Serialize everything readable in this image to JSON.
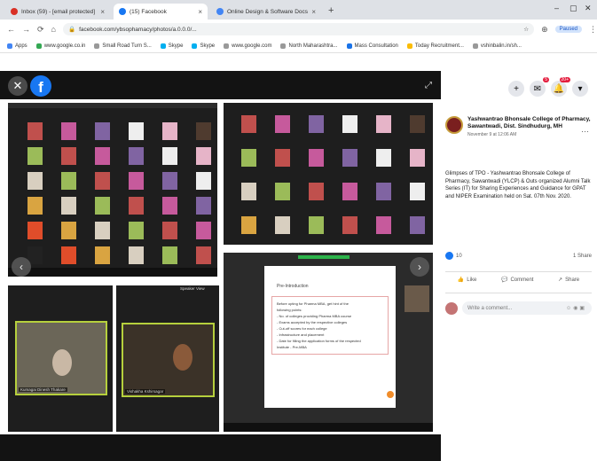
{
  "browser": {
    "tabs": [
      {
        "label": "Inbox (59) - [email protected]",
        "color": "#d93025",
        "active": false
      },
      {
        "label": "(15) Facebook",
        "color": "#1877f2",
        "active": true
      },
      {
        "label": "Online Design & Software Docs",
        "color": "#4285f4",
        "active": false
      }
    ],
    "url": "facebook.com/ybsophamacy/photos/a.0.0.0/...",
    "profile_status": "Paused",
    "bookmarks": [
      "Apps",
      "www.google.co.in",
      "Small Road Turn S...",
      "Skype",
      "Skype",
      "www.google.com",
      "North Maharashtra...",
      "Mass Consultation",
      "Today Recruitment...",
      "vshinbalin.in/sh..."
    ]
  },
  "viewer": {
    "speaker_view_label": "Speaker View",
    "slide": {
      "title": "Pre-Introduction",
      "lines": [
        "Before opting for Pharma MBA, get hint of the",
        "following points:",
        "- No. of colleges providing Pharma MBA course",
        "- Exams accepted by the respective colleges",
        "- Cut-off scores for each college",
        "- Infrastructure and placement",
        "- Date for filling the application forms of the respected",
        "  Institute - Pre-MBA"
      ]
    },
    "videos": [
      {
        "name": "Kumagai Dinesh Thakare"
      },
      {
        "name": "Vishakha Kshirsagar"
      }
    ]
  },
  "post": {
    "page_name": "Yashwantrao Bhonsale College of Pharmacy, Sawantwadi, Dist. Sindhudurg, MH",
    "meta": "November 9 at 12:06 AM",
    "text": "Glimpses of TPO - Yashwantrao Bhonsale College of Pharmacy, Sawantwadi (YLCP) & Outs organized Alumni Talk Series (IT) for Sharing Experiences and Guidance for GPAT and NIPER Examination held on Sat. 07th Nov. 2020.",
    "like_count": "10",
    "share_count": "1 Share",
    "actions": {
      "like": "Like",
      "comment": "Comment",
      "share": "Share"
    },
    "comment_placeholder": "Write a comment..."
  },
  "topbar": {
    "messenger_badge": "5",
    "notif_badge": "20+"
  }
}
